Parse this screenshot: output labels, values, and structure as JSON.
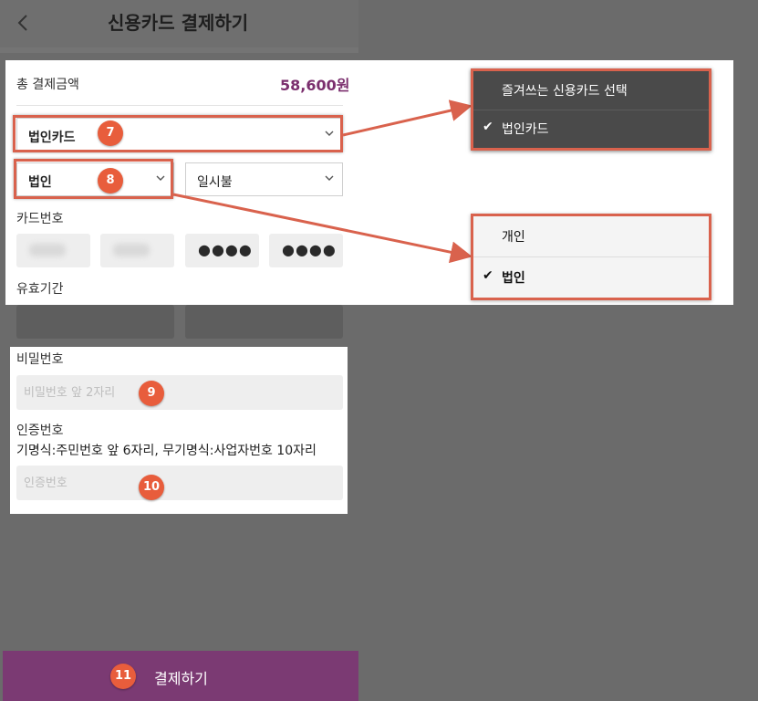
{
  "header": {
    "back_glyph": "<",
    "title": "신용카드 결제하기"
  },
  "summary": {
    "total_label": "총 결제금액",
    "total_amount": "58,600원"
  },
  "form": {
    "card_select_value": "법인카드",
    "type_select_value": "법인",
    "installment_select_value": "일시불",
    "card_number_label": "카드번호",
    "card_number_masked_3": "●●●●",
    "card_number_masked_4": "●●●●",
    "expiry_label": "유효기간",
    "password_label": "비밀번호",
    "password_placeholder": "비밀번호 앞 2자리",
    "auth_label": "인증번호",
    "auth_hint": "기명식:주민번호 앞 6자리, 무기명식:사업자번호 10자리",
    "auth_placeholder": "인증번호"
  },
  "pay_button": {
    "label": "결제하기"
  },
  "card_menu": {
    "items": [
      "즐겨쓰는 신용카드 선택",
      "법인카드"
    ],
    "selected": "법인카드"
  },
  "type_menu": {
    "items": [
      "개인",
      "법인"
    ],
    "selected": "법인"
  },
  "badges": {
    "b7": "7",
    "b8": "8",
    "b9": "9",
    "b10": "10",
    "b11": "11"
  },
  "colors": {
    "accent": "#7b3a73",
    "amount": "#7b2f6e",
    "annotation": "#e85d3c"
  },
  "check_glyph": "✔",
  "chevron_glyph": "⌄"
}
